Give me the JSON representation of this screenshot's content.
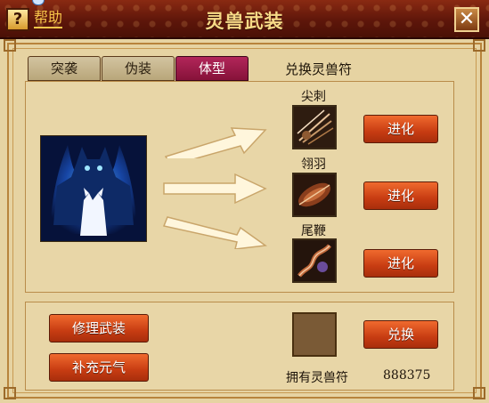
{
  "window": {
    "title": "灵兽武装",
    "help_label": "帮助",
    "help_glyph": "?",
    "close_glyph": "✕"
  },
  "tabs": [
    {
      "label": "突袭",
      "active": false
    },
    {
      "label": "伪装",
      "active": false
    },
    {
      "label": "体型",
      "active": true
    }
  ],
  "exchange": {
    "title": "兑换灵兽符"
  },
  "evolutions": [
    {
      "name": "尖刺",
      "button": "进化",
      "icon": "spike-icon"
    },
    {
      "name": "翎羽",
      "button": "进化",
      "icon": "feather-icon"
    },
    {
      "name": "尾鞭",
      "button": "进化",
      "icon": "tail-whip-icon"
    }
  ],
  "actions": {
    "repair": "修理武装",
    "replenish": "补充元气",
    "redeem": "兑换"
  },
  "inventory": {
    "owned_label": "拥有灵兽符",
    "owned_value": "888375"
  },
  "colors": {
    "accent": "#c73c12",
    "active_tab": "#9e1c4a",
    "title_bar": "#5e160a"
  }
}
